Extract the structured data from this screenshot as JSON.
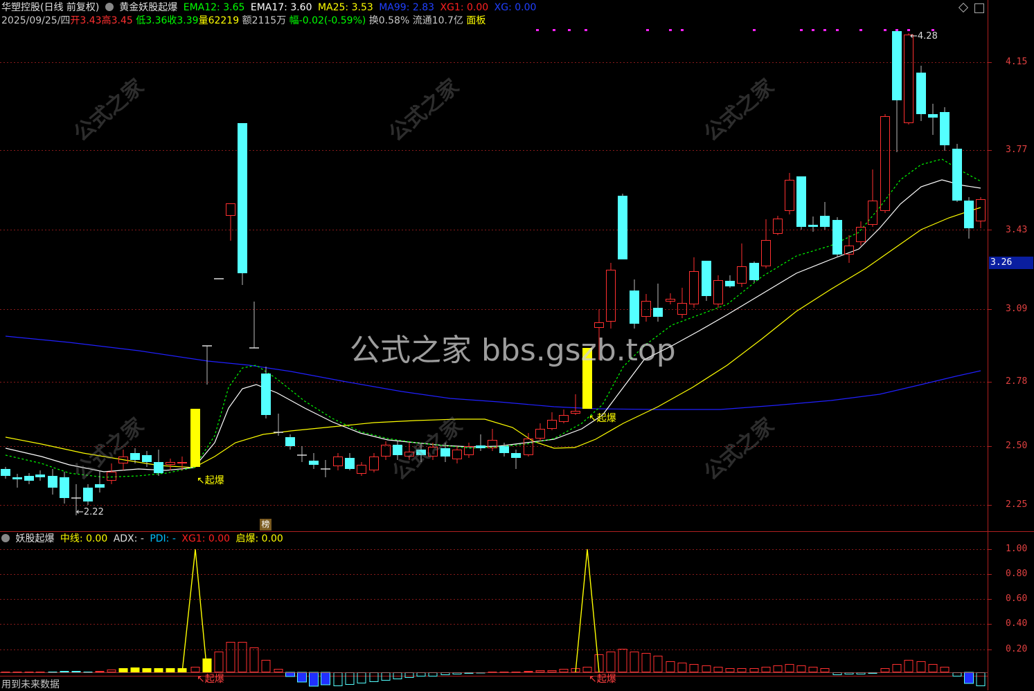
{
  "header": {
    "stock_name": "华塑控股(日线 前复权)",
    "indicator_name": "黄金妖股起爆",
    "ema12": "EMA12: 3.65",
    "ema17": "EMA17: 3.60",
    "ma25": "MA25: 3.53",
    "ma99": "MA99: 2.83",
    "xg1": "XG1: 0.00",
    "xg": "XG: 0.00",
    "date": "2025/09/25/四",
    "open_label": "开",
    "open": "3.43",
    "high_label": "高",
    "high": "3.45",
    "low_label": "低",
    "low": "3.36",
    "close_label": "收",
    "close": "3.39",
    "vol_label": "量",
    "vol": "62219",
    "amount_label": "额",
    "amount": "2115万",
    "change_label": "幅",
    "change": "-0.02(-0.59%)",
    "turnover_label": "换",
    "turnover": "0.58%",
    "float_label": "流通",
    "float": "10.7亿",
    "panel_label": "面板"
  },
  "sub_header": {
    "name": "妖股起爆",
    "mid": "中线: 0.00",
    "adx": "ADX: -",
    "pdi": "PDI: -",
    "xg1": "XG1: 0.00",
    "qibao": "启爆: 0.00"
  },
  "main_axis": [
    "4.15",
    "3.77",
    "3.43",
    "3.09",
    "2.78",
    "2.50",
    "2.25"
  ],
  "sub_axis": [
    "1.00",
    "0.80",
    "0.60",
    "0.40",
    "0.20"
  ],
  "current_price": "3.26",
  "annotations": {
    "high_mark": "4.28",
    "low_mark": "2.22",
    "qibao1": "起爆",
    "qibao2": "起爆",
    "qibao3": "起爆",
    "qibao4": "起爆",
    "bang": "榜"
  },
  "watermark": "公式之家 bbs.gszb.top",
  "wm_small": "公式之家",
  "footer": "用到未来数据",
  "colors": {
    "up": "#ff3030",
    "down": "#54ffff",
    "ema12": "#ffffff",
    "ema17": "#00ff00",
    "ma25": "#ffff00",
    "ma99": "#2020ff"
  }
}
